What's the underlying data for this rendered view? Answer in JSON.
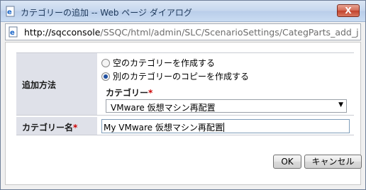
{
  "window": {
    "title": "カテゴリーの追加 -- Web ページ ダイアログ",
    "close_label": "X"
  },
  "address": {
    "host": "http://sqcconsole",
    "path": "/SSQC/html/admin/SLC/ScenarioSettings/CategParts_add_ja.h"
  },
  "form": {
    "add_method_label": "追加方法",
    "radio_empty_label": "空のカテゴリーを作成する",
    "radio_copy_label": "別のカテゴリーのコピーを作成する",
    "radio_empty_checked": false,
    "radio_copy_checked": true,
    "category_label": "カテゴリー",
    "category_selected": "VMware 仮想マシン再配置",
    "category_name_label": "カテゴリー名",
    "category_name_value": "My VMware 仮想マシン再配置",
    "required_mark": "*"
  },
  "buttons": {
    "ok": "OK",
    "cancel": "キャンセル"
  },
  "colors": {
    "label_bg": "#dfe1e9",
    "required": "#cc0000",
    "titlebar": "#c6d7ee"
  },
  "icons": {
    "title": "ie-page-icon",
    "address": "ie-page-icon",
    "select": "chevron-down-icon"
  }
}
